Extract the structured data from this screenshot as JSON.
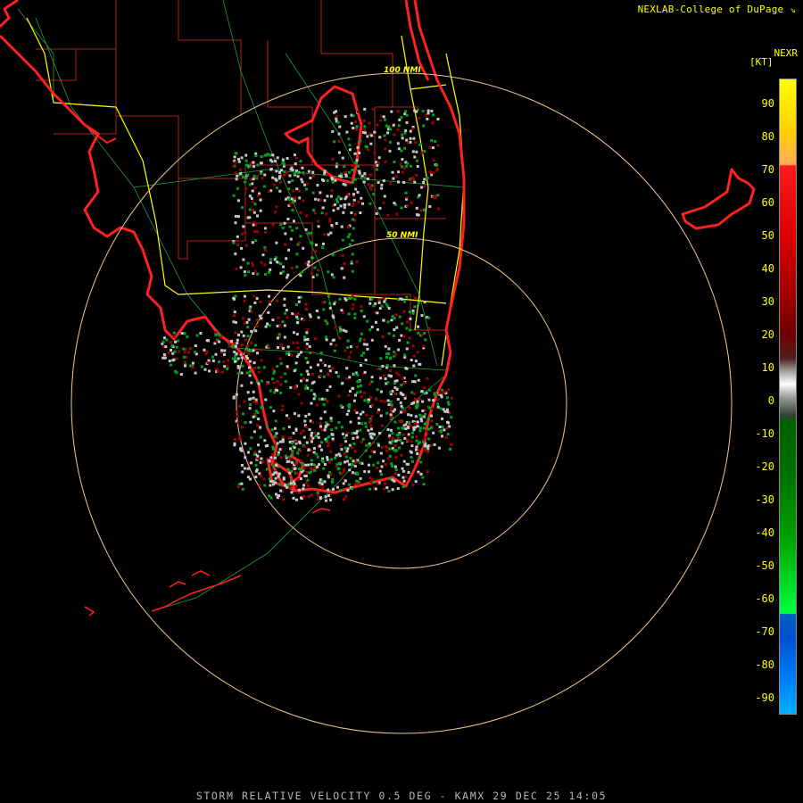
{
  "credit": "NEXLAB-College of DuPage",
  "product": "NEXR",
  "units": "[KT]",
  "status_line": "STORM RELATIVE VELOCITY 0.5 DEG - KAMX 29 DEC 25 14:05",
  "range_rings": {
    "inner_label": "50 NMI",
    "outer_label": "100 NMI"
  },
  "colorbar": {
    "ticks": [
      "90",
      "80",
      "70",
      "60",
      "50",
      "40",
      "30",
      "20",
      "10",
      "0",
      "-10",
      "-20",
      "-30",
      "-40",
      "-50",
      "-60",
      "-70",
      "-80",
      "-90"
    ]
  },
  "colors": {
    "coastline": "#ff2020",
    "county_lines": "#b02020",
    "highways": "#ffff00",
    "roads": "#20a040",
    "rings": "#f0c890",
    "outbound": "#a00000",
    "inbound": "#00a020",
    "near_zero": "#c8c8c8"
  }
}
